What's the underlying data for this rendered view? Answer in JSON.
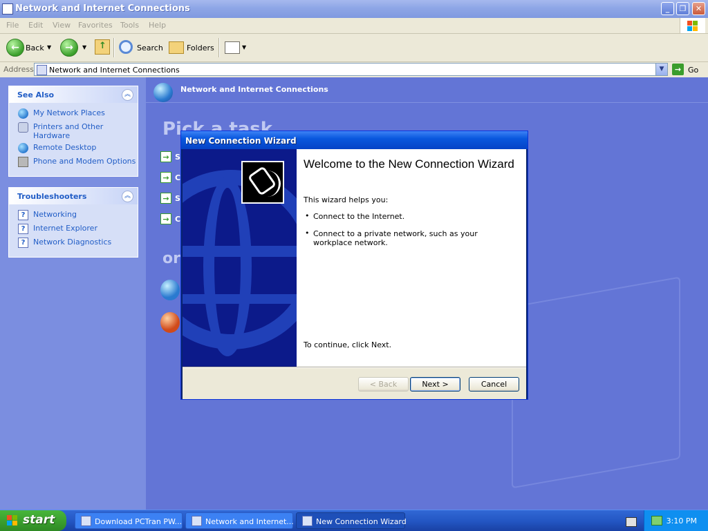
{
  "window": {
    "title": "Network and Internet Connections",
    "controls": {
      "minimize": "_",
      "maximize": "❐",
      "close": "✕"
    }
  },
  "menu": [
    "File",
    "Edit",
    "View",
    "Favorites",
    "Tools",
    "Help"
  ],
  "toolbar": {
    "back": "Back",
    "search": "Search",
    "folders": "Folders"
  },
  "address": {
    "label": "Address",
    "value": "Network and Internet Connections",
    "go": "Go"
  },
  "sidebar": {
    "see_also": {
      "title": "See Also",
      "items": [
        "My Network Places",
        "Printers and Other Hardware",
        "Remote Desktop",
        "Phone and Modem Options"
      ]
    },
    "troubleshooters": {
      "title": "Troubleshooters",
      "items": [
        "Networking",
        "Internet Explorer",
        "Network Diagnostics"
      ]
    }
  },
  "main": {
    "header": "Network and Internet Connections",
    "pick_task": "Pick a task...",
    "or": "or",
    "task_letters": [
      "S",
      "C",
      "S",
      "C"
    ]
  },
  "wizard": {
    "title": "New Connection Wizard",
    "heading": "Welcome to the New Connection Wizard",
    "intro": "This wizard helps you:",
    "bullets": [
      "Connect to the Internet.",
      "Connect to a private network, such as your workplace network."
    ],
    "continue": "To continue, click Next.",
    "buttons": {
      "back": "< Back",
      "next": "Next >",
      "cancel": "Cancel"
    }
  },
  "taskbar": {
    "start": "start",
    "tasks": [
      "Download PCTran PW...",
      "Network and Internet...",
      "New Connection Wizard"
    ],
    "clock": "3:10 PM"
  },
  "colors": {
    "desktop_blue": "#6375d6",
    "xp_title_blue": "#0a58de",
    "link_blue": "#215dc6",
    "start_green": "#3a9d2c"
  }
}
